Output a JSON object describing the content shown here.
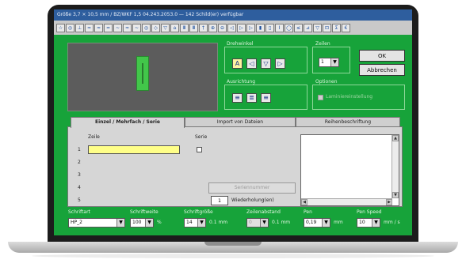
{
  "window": {
    "title": "Größe 3,7 × 10,5 mm / BZ/WKF 1,5 04.243.2053.0 — 142 Schild(er) verfügbar"
  },
  "toolbar": {
    "icons": [
      "☆",
      "◎",
      "⊥",
      "≈",
      "≈",
      "═",
      "~",
      "≈",
      "~",
      "◎",
      "◇",
      "▽",
      "⌂",
      "Ⅲ",
      "Ⅲ",
      "†",
      "⊕",
      "⊖",
      "◁",
      "▷",
      "▷",
      "▮",
      "▯",
      "Ⅰ",
      "◯",
      "≤",
      "⊿",
      "▽",
      "⊡",
      "Σ",
      "€"
    ]
  },
  "drehwinkel": {
    "title": "Drehwinkel",
    "buttons": [
      "A",
      "◁",
      "▽",
      "▷"
    ]
  },
  "zeilen": {
    "title": "Zeilen",
    "value": "1"
  },
  "actions": {
    "ok_label": "OK",
    "cancel_label": "Abbrechen"
  },
  "ausrichtung": {
    "title": "Ausrichtung",
    "buttons": [
      "≡",
      "≣",
      "≡"
    ]
  },
  "optionen": {
    "title": "Optionen",
    "checkbox_label": "Laminiereinstellung"
  },
  "tabs": {
    "tab1": "Einzel / Mehrfach / Serie",
    "tab2": "Import von Dateien",
    "tab3": "Reihenbeschriftung"
  },
  "panel": {
    "zeile_label": "Zeile",
    "serie_label": "Serie",
    "rows": [
      "1",
      "2",
      "3",
      "4",
      "5"
    ],
    "series_button": "Seriennummer",
    "repeat_value": "1",
    "repeat_label": "Wiederholung(en)"
  },
  "bottom": {
    "schriftart": {
      "label": "Schriftart",
      "value": "HP_2"
    },
    "schriftweite": {
      "label": "Schriftweite",
      "value": "100",
      "unit": "%"
    },
    "schriftgroesse": {
      "label": "Schriftgröße",
      "value": "14",
      "unit": "0.1 mm"
    },
    "zeilenabstand": {
      "label": "Zeilenabstand",
      "value": "0",
      "unit": "0.1 mm"
    },
    "pen": {
      "label": "Pen",
      "value": "0,19",
      "unit": "mm"
    },
    "pen_speed": {
      "label": "Pen Speed",
      "value": "10",
      "unit": "mm / s"
    }
  }
}
